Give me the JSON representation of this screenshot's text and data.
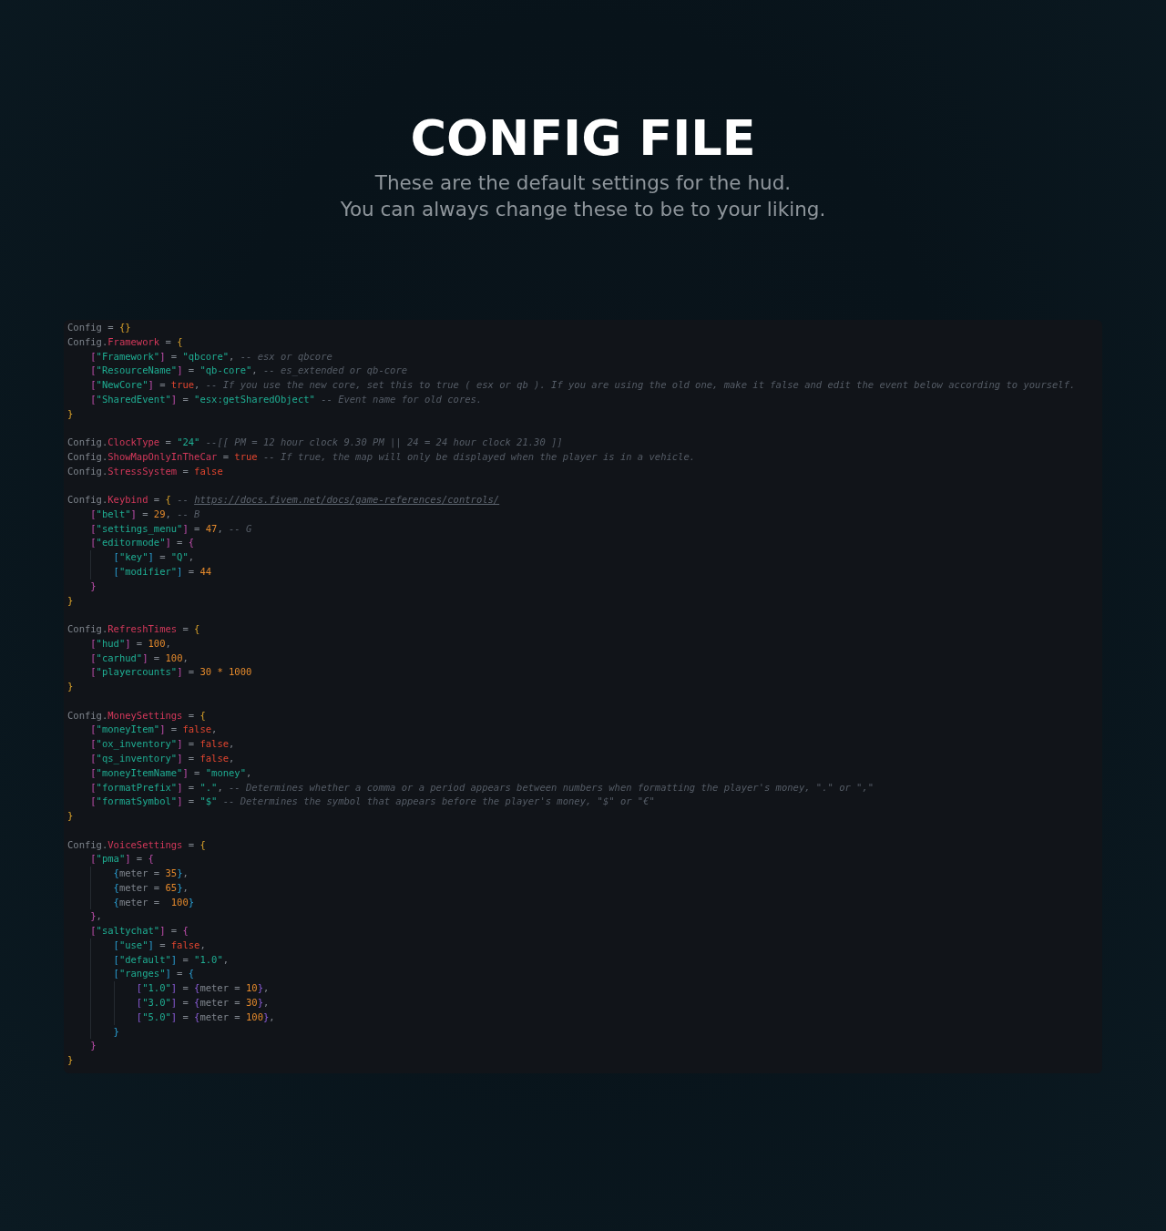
{
  "header": {
    "title": "CONFIG FILE",
    "subtitle_lines": [
      "These are the default settings for the hud.",
      "You can always change these to be to your liking."
    ]
  },
  "code": {
    "lines": [
      {
        "kind": "code",
        "tokens": [
          {
            "kind": "plain",
            "text": "Config = "
          },
          {
            "kind": "b",
            "text": "{}"
          }
        ]
      },
      {
        "kind": "code",
        "tokens": [
          {
            "kind": "plain",
            "text": "Config."
          },
          {
            "kind": "prop",
            "text": "Framework"
          },
          {
            "kind": "plain",
            "text": " = "
          },
          {
            "kind": "b",
            "text": "{"
          }
        ],
        "children": [
          {
            "kind": "code",
            "tokens": [
              {
                "kind": "b",
                "text": "["
              },
              {
                "kind": "str",
                "text": "\"Framework\""
              },
              {
                "kind": "b",
                "text": "]"
              },
              {
                "kind": "plain",
                "text": " = "
              },
              {
                "kind": "str",
                "text": "\"qbcore\""
              },
              {
                "kind": "plain",
                "text": ", "
              },
              {
                "kind": "com",
                "text": "-- esx or qbcore"
              }
            ]
          },
          {
            "kind": "code",
            "tokens": [
              {
                "kind": "b",
                "text": "["
              },
              {
                "kind": "str",
                "text": "\"ResourceName\""
              },
              {
                "kind": "b",
                "text": "]"
              },
              {
                "kind": "plain",
                "text": " = "
              },
              {
                "kind": "str",
                "text": "\"qb-core\""
              },
              {
                "kind": "plain",
                "text": ", "
              },
              {
                "kind": "com",
                "text": "-- es_extended or qb-core"
              }
            ]
          },
          {
            "kind": "code",
            "tokens": [
              {
                "kind": "b",
                "text": "["
              },
              {
                "kind": "str",
                "text": "\"NewCore\""
              },
              {
                "kind": "b",
                "text": "]"
              },
              {
                "kind": "plain",
                "text": " = "
              },
              {
                "kind": "bool",
                "text": "true"
              },
              {
                "kind": "plain",
                "text": ", "
              },
              {
                "kind": "com",
                "text": "-- If you use the new core, set this to true ( esx or qb ). If you are using the old one, make it false and edit the event below according to yourself."
              }
            ]
          },
          {
            "kind": "code",
            "tokens": [
              {
                "kind": "b",
                "text": "["
              },
              {
                "kind": "str",
                "text": "\"SharedEvent\""
              },
              {
                "kind": "b",
                "text": "]"
              },
              {
                "kind": "plain",
                "text": " = "
              },
              {
                "kind": "str",
                "text": "\"esx:getSharedObject\""
              },
              {
                "kind": "com",
                "text": " -- Event name for old cores."
              }
            ]
          }
        ]
      },
      {
        "kind": "code",
        "tokens": [
          {
            "kind": "b",
            "text": "}"
          }
        ]
      },
      {
        "kind": "blank"
      },
      {
        "kind": "code",
        "tokens": [
          {
            "kind": "plain",
            "text": "Config."
          },
          {
            "kind": "prop",
            "text": "ClockType"
          },
          {
            "kind": "plain",
            "text": " = "
          },
          {
            "kind": "str",
            "text": "\"24\""
          },
          {
            "kind": "com",
            "text": " --[[ PM = 12 hour clock 9.30 PM || 24 = 24 hour clock 21.30 ]]"
          }
        ]
      },
      {
        "kind": "code",
        "tokens": [
          {
            "kind": "plain",
            "text": "Config."
          },
          {
            "kind": "prop",
            "text": "ShowMapOnlyInTheCar"
          },
          {
            "kind": "plain",
            "text": " = "
          },
          {
            "kind": "bool",
            "text": "true"
          },
          {
            "kind": "com",
            "text": " -- If true, the map will only be displayed when the player is in a vehicle."
          }
        ]
      },
      {
        "kind": "code",
        "tokens": [
          {
            "kind": "plain",
            "text": "Config."
          },
          {
            "kind": "prop",
            "text": "StressSystem"
          },
          {
            "kind": "plain",
            "text": " = "
          },
          {
            "kind": "bool",
            "text": "false"
          }
        ]
      },
      {
        "kind": "blank"
      },
      {
        "kind": "code",
        "tokens": [
          {
            "kind": "plain",
            "text": "Config."
          },
          {
            "kind": "prop",
            "text": "Keybind"
          },
          {
            "kind": "plain",
            "text": " = "
          },
          {
            "kind": "b",
            "text": "{"
          },
          {
            "kind": "com",
            "text": " -- "
          },
          {
            "kind": "link",
            "text": "https://docs.fivem.net/docs/game-references/controls/"
          }
        ],
        "children": [
          {
            "kind": "code",
            "tokens": [
              {
                "kind": "b",
                "text": "["
              },
              {
                "kind": "str",
                "text": "\"belt\""
              },
              {
                "kind": "b",
                "text": "]"
              },
              {
                "kind": "plain",
                "text": " = "
              },
              {
                "kind": "num",
                "text": "29"
              },
              {
                "kind": "plain",
                "text": ", "
              },
              {
                "kind": "com",
                "text": "-- B"
              }
            ]
          },
          {
            "kind": "code",
            "tokens": [
              {
                "kind": "b",
                "text": "["
              },
              {
                "kind": "str",
                "text": "\"settings_menu\""
              },
              {
                "kind": "b",
                "text": "]"
              },
              {
                "kind": "plain",
                "text": " = "
              },
              {
                "kind": "num",
                "text": "47"
              },
              {
                "kind": "plain",
                "text": ", "
              },
              {
                "kind": "com",
                "text": "-- G"
              }
            ]
          },
          {
            "kind": "code",
            "tokens": [
              {
                "kind": "b",
                "text": "["
              },
              {
                "kind": "str",
                "text": "\"editormode\""
              },
              {
                "kind": "b",
                "text": "]"
              },
              {
                "kind": "plain",
                "text": " = "
              },
              {
                "kind": "b",
                "text": "{"
              }
            ],
            "children": [
              {
                "kind": "code",
                "tokens": [
                  {
                    "kind": "b",
                    "text": "["
                  },
                  {
                    "kind": "str",
                    "text": "\"key\""
                  },
                  {
                    "kind": "b",
                    "text": "]"
                  },
                  {
                    "kind": "plain",
                    "text": " = "
                  },
                  {
                    "kind": "str",
                    "text": "\"Q\""
                  },
                  {
                    "kind": "plain",
                    "text": ","
                  }
                ]
              },
              {
                "kind": "code",
                "tokens": [
                  {
                    "kind": "b",
                    "text": "["
                  },
                  {
                    "kind": "str",
                    "text": "\"modifier\""
                  },
                  {
                    "kind": "b",
                    "text": "]"
                  },
                  {
                    "kind": "plain",
                    "text": " = "
                  },
                  {
                    "kind": "num",
                    "text": "44"
                  }
                ]
              }
            ]
          },
          {
            "kind": "code",
            "tokens": [
              {
                "kind": "b",
                "text": "}"
              }
            ]
          }
        ]
      },
      {
        "kind": "code",
        "tokens": [
          {
            "kind": "b",
            "text": "}"
          }
        ]
      },
      {
        "kind": "blank"
      },
      {
        "kind": "code",
        "tokens": [
          {
            "kind": "plain",
            "text": "Config."
          },
          {
            "kind": "prop",
            "text": "RefreshTimes"
          },
          {
            "kind": "plain",
            "text": " = "
          },
          {
            "kind": "b",
            "text": "{"
          }
        ],
        "children": [
          {
            "kind": "code",
            "tokens": [
              {
                "kind": "b",
                "text": "["
              },
              {
                "kind": "str",
                "text": "\"hud\""
              },
              {
                "kind": "b",
                "text": "]"
              },
              {
                "kind": "plain",
                "text": " = "
              },
              {
                "kind": "num",
                "text": "100"
              },
              {
                "kind": "plain",
                "text": ","
              }
            ]
          },
          {
            "kind": "code",
            "tokens": [
              {
                "kind": "b",
                "text": "["
              },
              {
                "kind": "str",
                "text": "\"carhud\""
              },
              {
                "kind": "b",
                "text": "]"
              },
              {
                "kind": "plain",
                "text": " = "
              },
              {
                "kind": "num",
                "text": "100"
              },
              {
                "kind": "plain",
                "text": ","
              }
            ]
          },
          {
            "kind": "code",
            "tokens": [
              {
                "kind": "b",
                "text": "["
              },
              {
                "kind": "str",
                "text": "\"playercounts\""
              },
              {
                "kind": "b",
                "text": "]"
              },
              {
                "kind": "plain",
                "text": " = "
              },
              {
                "kind": "num",
                "text": "30 * 1000"
              }
            ]
          }
        ]
      },
      {
        "kind": "code",
        "tokens": [
          {
            "kind": "b",
            "text": "}"
          }
        ]
      },
      {
        "kind": "blank"
      },
      {
        "kind": "code",
        "tokens": [
          {
            "kind": "plain",
            "text": "Config."
          },
          {
            "kind": "prop",
            "text": "MoneySettings"
          },
          {
            "kind": "plain",
            "text": " = "
          },
          {
            "kind": "b",
            "text": "{"
          }
        ],
        "children": [
          {
            "kind": "code",
            "tokens": [
              {
                "kind": "b",
                "text": "["
              },
              {
                "kind": "str",
                "text": "\"moneyItem\""
              },
              {
                "kind": "b",
                "text": "]"
              },
              {
                "kind": "plain",
                "text": " = "
              },
              {
                "kind": "bool",
                "text": "false"
              },
              {
                "kind": "plain",
                "text": ","
              }
            ]
          },
          {
            "kind": "code",
            "tokens": [
              {
                "kind": "b",
                "text": "["
              },
              {
                "kind": "str",
                "text": "\"ox_inventory\""
              },
              {
                "kind": "b",
                "text": "]"
              },
              {
                "kind": "plain",
                "text": " = "
              },
              {
                "kind": "bool",
                "text": "false"
              },
              {
                "kind": "plain",
                "text": ","
              }
            ]
          },
          {
            "kind": "code",
            "tokens": [
              {
                "kind": "b",
                "text": "["
              },
              {
                "kind": "str",
                "text": "\"qs_inventory\""
              },
              {
                "kind": "b",
                "text": "]"
              },
              {
                "kind": "plain",
                "text": " = "
              },
              {
                "kind": "bool",
                "text": "false"
              },
              {
                "kind": "plain",
                "text": ","
              }
            ]
          },
          {
            "kind": "code",
            "tokens": [
              {
                "kind": "b",
                "text": "["
              },
              {
                "kind": "str",
                "text": "\"moneyItemName\""
              },
              {
                "kind": "b",
                "text": "]"
              },
              {
                "kind": "plain",
                "text": " = "
              },
              {
                "kind": "str",
                "text": "\"money\""
              },
              {
                "kind": "plain",
                "text": ","
              }
            ]
          },
          {
            "kind": "code",
            "tokens": [
              {
                "kind": "b",
                "text": "["
              },
              {
                "kind": "str",
                "text": "\"formatPrefix\""
              },
              {
                "kind": "b",
                "text": "]"
              },
              {
                "kind": "plain",
                "text": " = "
              },
              {
                "kind": "str",
                "text": "\".\""
              },
              {
                "kind": "plain",
                "text": ", "
              },
              {
                "kind": "com",
                "text": "-- Determines whether a comma or a period appears between numbers when formatting the player's money, \".\" or \",\""
              }
            ]
          },
          {
            "kind": "code",
            "tokens": [
              {
                "kind": "b",
                "text": "["
              },
              {
                "kind": "str",
                "text": "\"formatSymbol\""
              },
              {
                "kind": "b",
                "text": "]"
              },
              {
                "kind": "plain",
                "text": " = "
              },
              {
                "kind": "str",
                "text": "\"$\""
              },
              {
                "kind": "com",
                "text": " -- Determines the symbol that appears before the player's money, \"$\" or \"€\""
              }
            ]
          }
        ]
      },
      {
        "kind": "code",
        "tokens": [
          {
            "kind": "b",
            "text": "}"
          }
        ]
      },
      {
        "kind": "blank"
      },
      {
        "kind": "code",
        "tokens": [
          {
            "kind": "plain",
            "text": "Config."
          },
          {
            "kind": "prop",
            "text": "VoiceSettings"
          },
          {
            "kind": "plain",
            "text": " = "
          },
          {
            "kind": "b",
            "text": "{"
          }
        ],
        "children": [
          {
            "kind": "code",
            "tokens": [
              {
                "kind": "b",
                "text": "["
              },
              {
                "kind": "str",
                "text": "\"pma\""
              },
              {
                "kind": "b",
                "text": "]"
              },
              {
                "kind": "plain",
                "text": " = "
              },
              {
                "kind": "b",
                "text": "{"
              }
            ],
            "children": [
              {
                "kind": "code",
                "tokens": [
                  {
                    "kind": "b",
                    "text": "{"
                  },
                  {
                    "kind": "plain",
                    "text": "meter = "
                  },
                  {
                    "kind": "num",
                    "text": "35"
                  },
                  {
                    "kind": "b",
                    "text": "}"
                  },
                  {
                    "kind": "plain",
                    "text": ","
                  }
                ]
              },
              {
                "kind": "code",
                "tokens": [
                  {
                    "kind": "b",
                    "text": "{"
                  },
                  {
                    "kind": "plain",
                    "text": "meter = "
                  },
                  {
                    "kind": "num",
                    "text": "65"
                  },
                  {
                    "kind": "b",
                    "text": "}"
                  },
                  {
                    "kind": "plain",
                    "text": ","
                  }
                ]
              },
              {
                "kind": "code",
                "tokens": [
                  {
                    "kind": "b",
                    "text": "{"
                  },
                  {
                    "kind": "plain",
                    "text": "meter =  "
                  },
                  {
                    "kind": "num",
                    "text": "100"
                  },
                  {
                    "kind": "b",
                    "text": "}"
                  }
                ]
              }
            ]
          },
          {
            "kind": "code",
            "tokens": [
              {
                "kind": "b",
                "text": "}"
              },
              {
                "kind": "plain",
                "text": ","
              }
            ]
          },
          {
            "kind": "code",
            "tokens": [
              {
                "kind": "b",
                "text": "["
              },
              {
                "kind": "str",
                "text": "\"saltychat\""
              },
              {
                "kind": "b",
                "text": "]"
              },
              {
                "kind": "plain",
                "text": " = "
              },
              {
                "kind": "b",
                "text": "{"
              }
            ],
            "children": [
              {
                "kind": "code",
                "tokens": [
                  {
                    "kind": "b",
                    "text": "["
                  },
                  {
                    "kind": "str",
                    "text": "\"use\""
                  },
                  {
                    "kind": "b",
                    "text": "]"
                  },
                  {
                    "kind": "plain",
                    "text": " = "
                  },
                  {
                    "kind": "bool",
                    "text": "false"
                  },
                  {
                    "kind": "plain",
                    "text": ","
                  }
                ]
              },
              {
                "kind": "code",
                "tokens": [
                  {
                    "kind": "b",
                    "text": "["
                  },
                  {
                    "kind": "str",
                    "text": "\"default\""
                  },
                  {
                    "kind": "b",
                    "text": "]"
                  },
                  {
                    "kind": "plain",
                    "text": " = "
                  },
                  {
                    "kind": "str",
                    "text": "\"1.0\""
                  },
                  {
                    "kind": "plain",
                    "text": ","
                  }
                ]
              },
              {
                "kind": "code",
                "tokens": [
                  {
                    "kind": "b",
                    "text": "["
                  },
                  {
                    "kind": "str",
                    "text": "\"ranges\""
                  },
                  {
                    "kind": "b",
                    "text": "]"
                  },
                  {
                    "kind": "plain",
                    "text": " = "
                  },
                  {
                    "kind": "b",
                    "text": "{"
                  }
                ],
                "children": [
                  {
                    "kind": "code",
                    "tokens": [
                      {
                        "kind": "b",
                        "text": "["
                      },
                      {
                        "kind": "str",
                        "text": "\"1.0\""
                      },
                      {
                        "kind": "b",
                        "text": "]"
                      },
                      {
                        "kind": "plain",
                        "text": " = "
                      },
                      {
                        "kind": "b",
                        "text": "{"
                      },
                      {
                        "kind": "plain",
                        "text": "meter = "
                      },
                      {
                        "kind": "num",
                        "text": "10"
                      },
                      {
                        "kind": "b",
                        "text": "}"
                      },
                      {
                        "kind": "plain",
                        "text": ","
                      }
                    ]
                  },
                  {
                    "kind": "code",
                    "tokens": [
                      {
                        "kind": "b",
                        "text": "["
                      },
                      {
                        "kind": "str",
                        "text": "\"3.0\""
                      },
                      {
                        "kind": "b",
                        "text": "]"
                      },
                      {
                        "kind": "plain",
                        "text": " = "
                      },
                      {
                        "kind": "b",
                        "text": "{"
                      },
                      {
                        "kind": "plain",
                        "text": "meter = "
                      },
                      {
                        "kind": "num",
                        "text": "30"
                      },
                      {
                        "kind": "b",
                        "text": "}"
                      },
                      {
                        "kind": "plain",
                        "text": ","
                      }
                    ]
                  },
                  {
                    "kind": "code",
                    "tokens": [
                      {
                        "kind": "b",
                        "text": "["
                      },
                      {
                        "kind": "str",
                        "text": "\"5.0\""
                      },
                      {
                        "kind": "b",
                        "text": "]"
                      },
                      {
                        "kind": "plain",
                        "text": " = "
                      },
                      {
                        "kind": "b",
                        "text": "{"
                      },
                      {
                        "kind": "plain",
                        "text": "meter = "
                      },
                      {
                        "kind": "num",
                        "text": "100"
                      },
                      {
                        "kind": "b",
                        "text": "}"
                      },
                      {
                        "kind": "plain",
                        "text": ","
                      }
                    ]
                  }
                ]
              },
              {
                "kind": "code",
                "tokens": [
                  {
                    "kind": "b",
                    "text": "}"
                  }
                ]
              }
            ]
          },
          {
            "kind": "code",
            "tokens": [
              {
                "kind": "b",
                "text": "}"
              }
            ]
          }
        ]
      },
      {
        "kind": "code",
        "tokens": [
          {
            "kind": "b",
            "text": "}"
          }
        ]
      }
    ]
  }
}
